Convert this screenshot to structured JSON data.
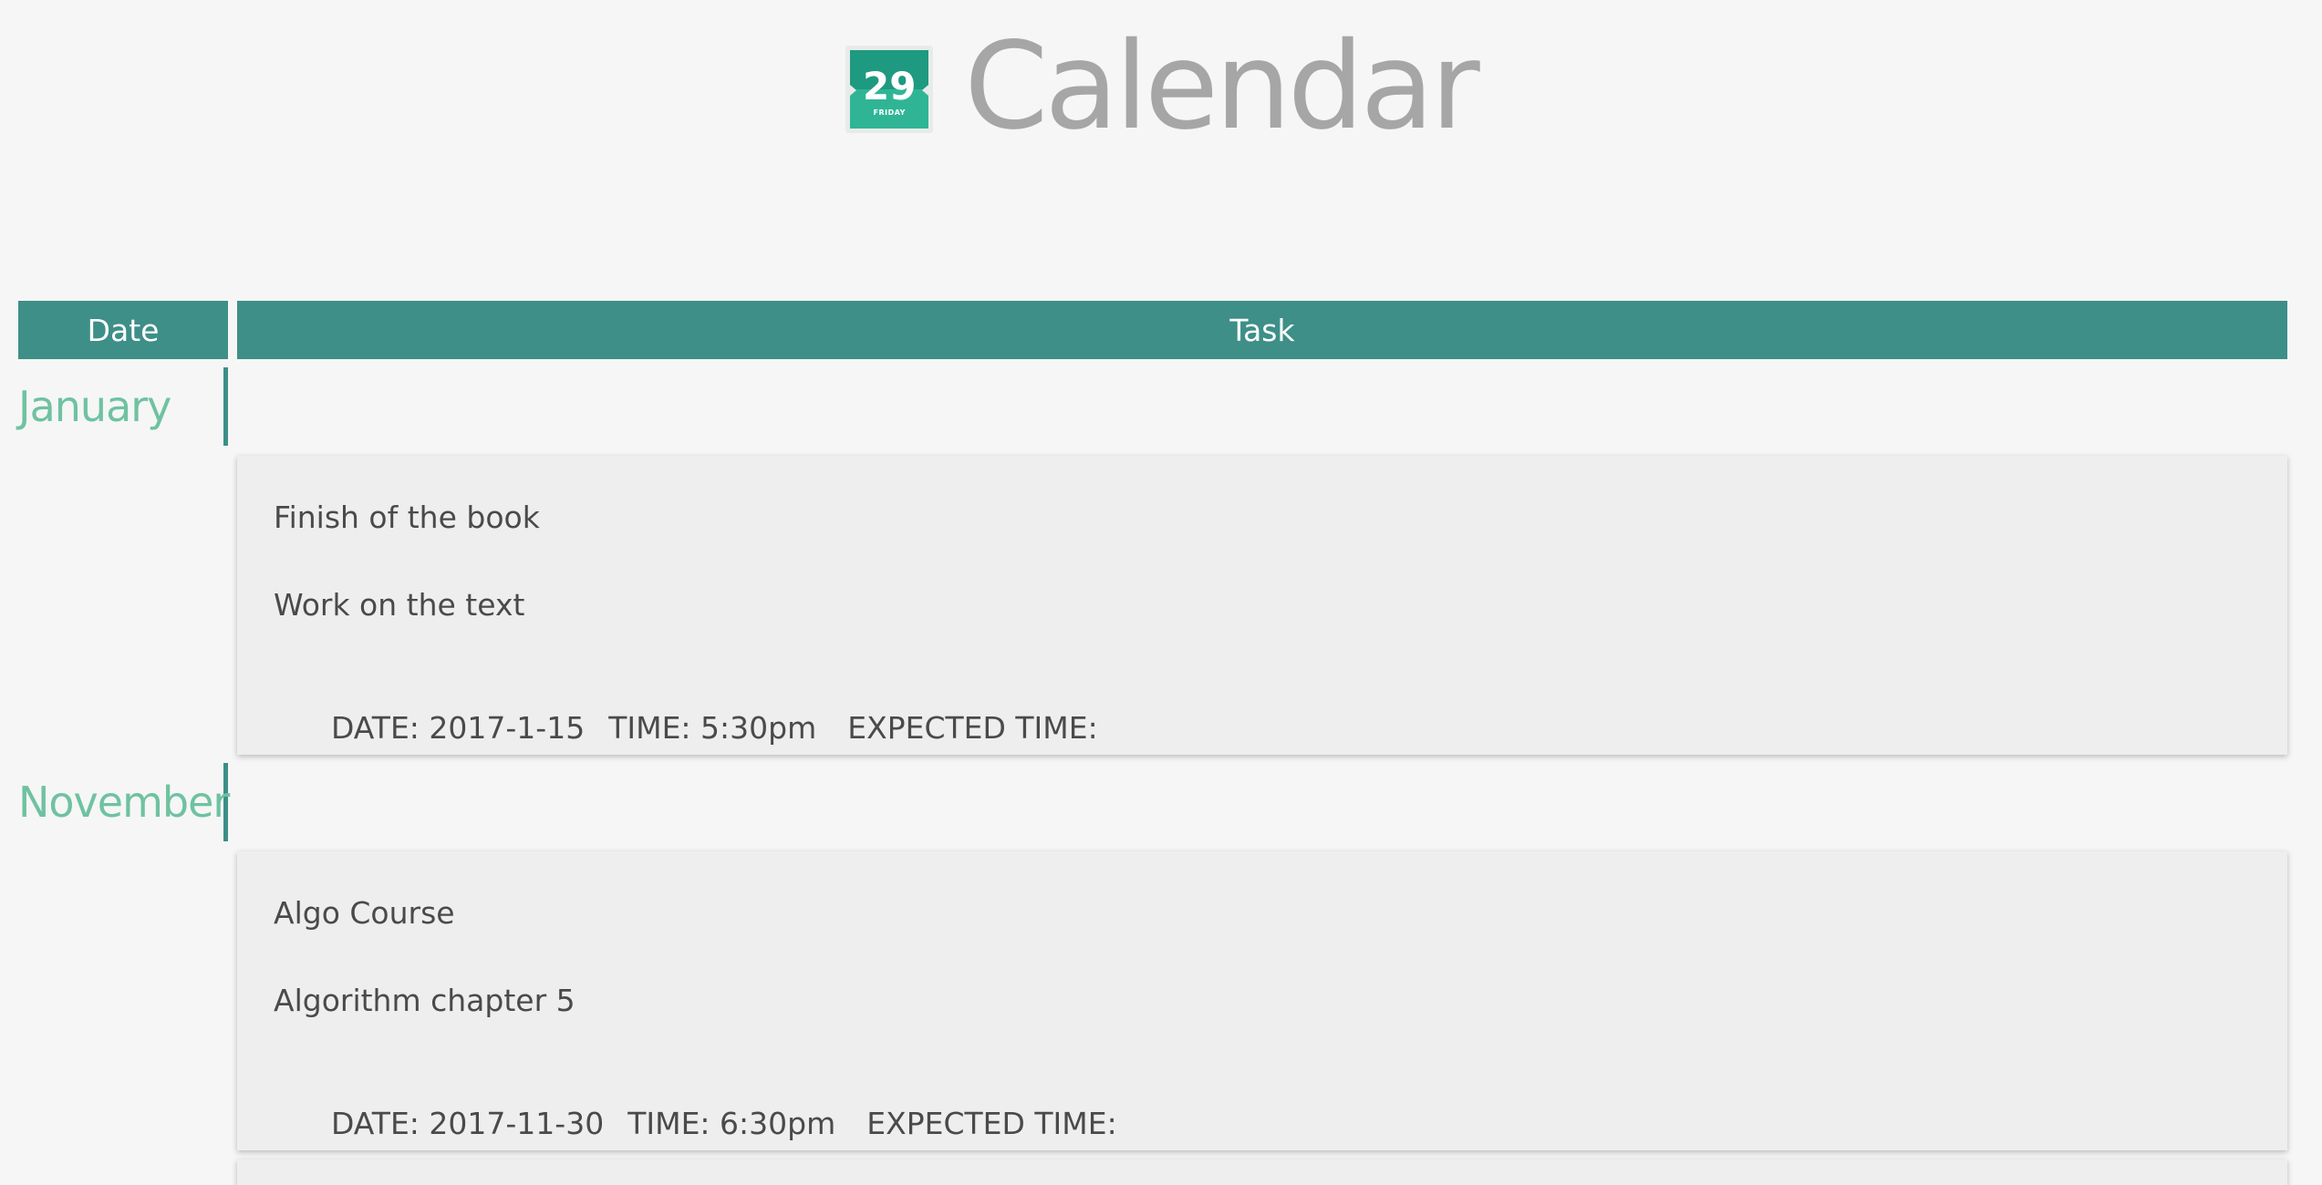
{
  "header": {
    "icon": {
      "name": "calendar-icon",
      "day": "29",
      "weekday": "FRIDAY",
      "colors": {
        "top": "#1e9a80",
        "bottom": "#2fb596"
      }
    },
    "title": "Calendar"
  },
  "table": {
    "columns": {
      "date": "Date",
      "task": "Task"
    },
    "accent_color": "#3d8f88",
    "month_color": "#6fc2a1",
    "groups": [
      {
        "month": "January",
        "tasks": [
          {
            "title": "Finish of the book",
            "description": "Work on the text",
            "date_label": "DATE: 2017-1-15",
            "time_label": "TIME: 5:30pm",
            "expected_label": "EXPECTED TIME:"
          }
        ]
      },
      {
        "month": "November",
        "tasks": [
          {
            "title": "Algo Course",
            "description": "Algorithm chapter 5",
            "date_label": "DATE: 2017-11-30",
            "time_label": "TIME: 6:30pm",
            "expected_label": "EXPECTED TIME:"
          }
        ]
      }
    ]
  }
}
